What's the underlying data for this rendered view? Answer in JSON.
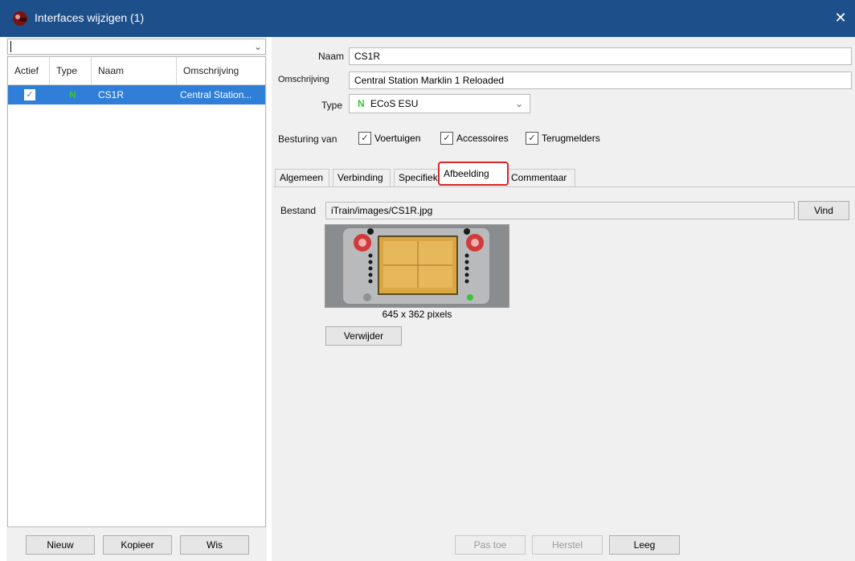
{
  "window": {
    "title": "Interfaces wijzigen (1)",
    "close_glyph": "✕"
  },
  "left_panel": {
    "filter_value": "",
    "columns": [
      "Actief",
      "Type",
      "Naam",
      "Omschrijving"
    ],
    "rows": [
      {
        "actief": "✓",
        "type": "N",
        "naam": "CS1R",
        "omschrijving": "Central Station..."
      }
    ],
    "buttons": {
      "new": "Nieuw",
      "copy": "Kopieer",
      "delete": "Wis"
    }
  },
  "form": {
    "naam_label": "Naam",
    "naam_value": "CS1R",
    "omschrijving_label": "Omschrijving",
    "omschrijving_value": "Central Station Marklin 1 Reloaded",
    "type_label": "Type",
    "type_prefix": "N",
    "type_value": "ECoS ESU",
    "besturing_label": "Besturing van",
    "checks": [
      {
        "label": "Voertuigen",
        "checked": true
      },
      {
        "label": "Accessoires",
        "checked": true
      },
      {
        "label": "Terugmelders",
        "checked": true
      }
    ]
  },
  "tabs": [
    "Algemeen",
    "Verbinding",
    "Specifiek",
    "Afbeelding",
    "Commentaar"
  ],
  "active_tab": "Afbeelding",
  "afbeelding": {
    "bestand_label": "Bestand",
    "bestand_value": "iTrain/images/CS1R.jpg",
    "find_button": "Vind",
    "size_text": "645 x 362 pixels",
    "remove_button": "Verwijder"
  },
  "bottom_buttons": {
    "apply": "Pas toe",
    "restore": "Herstel",
    "clear": "Leeg"
  },
  "colors": {
    "titlebar": "#1d4f8b",
    "selection": "#2f7ed8",
    "highlight_border": "#d92626",
    "type_n": "#3ac63a"
  }
}
